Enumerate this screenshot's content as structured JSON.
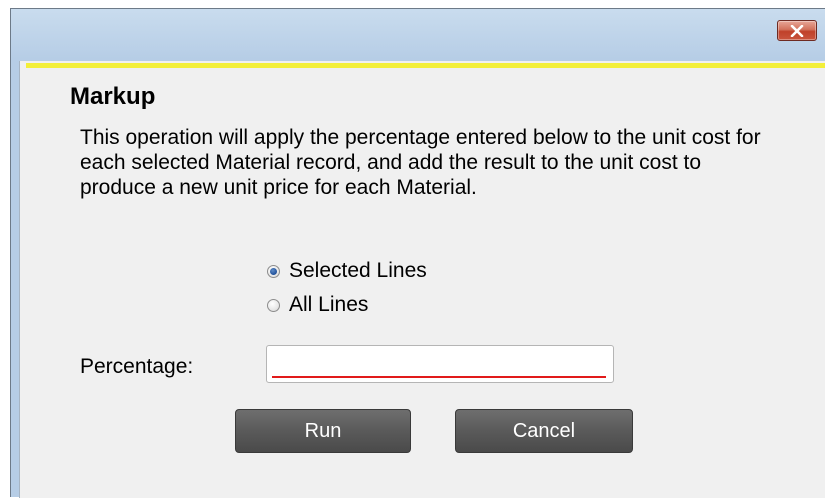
{
  "window": {
    "close_label": "Close"
  },
  "dialog": {
    "title": "Markup",
    "description": "This operation will apply the percentage entered below to the unit cost for each selected Material record, and add the result to the unit cost to produce a new unit price for each Material.",
    "scope_options": [
      {
        "label": "Selected Lines",
        "selected": true
      },
      {
        "label": "All Lines",
        "selected": false
      }
    ],
    "percentage": {
      "label": "Percentage:",
      "value": "",
      "placeholder": ""
    },
    "buttons": {
      "run": "Run",
      "cancel": "Cancel"
    }
  },
  "colors": {
    "accent_line": "#f3ef3a",
    "validation_underline": "#e11a1a",
    "close_button": "#c9553e",
    "button_bg": "#5a5a5a"
  },
  "icons": {
    "close": "close-x-icon"
  }
}
